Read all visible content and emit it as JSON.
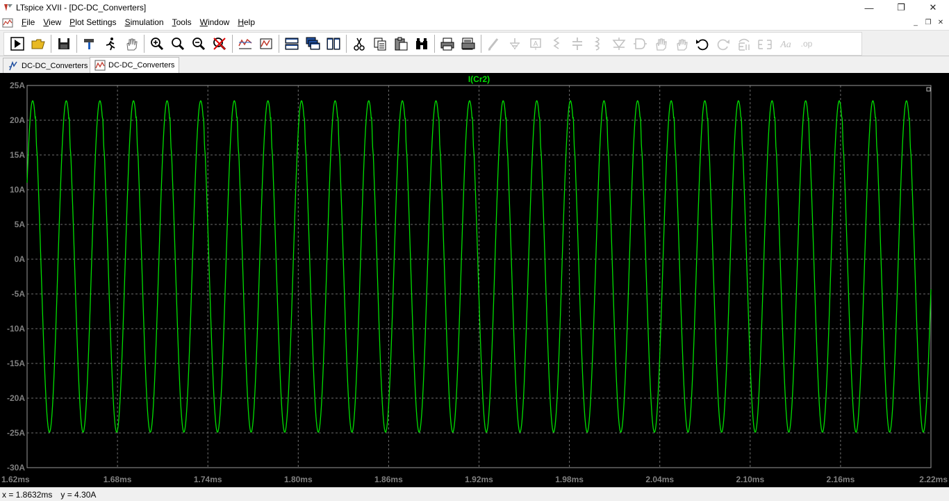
{
  "window": {
    "title": "LTspice XVII - [DC-DC_Converters]",
    "minimize": "—",
    "maximize": "❐",
    "close": "✕"
  },
  "menu": {
    "items": [
      {
        "label": "File",
        "accel": "F",
        "rest": "ile"
      },
      {
        "label": "View",
        "accel": "V",
        "rest": "iew"
      },
      {
        "label": "Plot Settings",
        "accel": "P",
        "rest": "lot Settings"
      },
      {
        "label": "Simulation",
        "accel": "S",
        "rest": "imulation"
      },
      {
        "label": "Tools",
        "accel": "T",
        "rest": "ools"
      },
      {
        "label": "Window",
        "accel": "W",
        "rest": "indow"
      },
      {
        "label": "Help",
        "accel": "H",
        "rest": "elp"
      }
    ],
    "mdi_min": "_",
    "mdi_restore": "❐",
    "mdi_close": "✕"
  },
  "tabs": [
    {
      "label": "DC-DC_Converters",
      "icon": "schematic-icon",
      "active": false
    },
    {
      "label": "DC-DC_Converters",
      "icon": "waveform-icon",
      "active": true
    }
  ],
  "toolbar": {
    "groups": [
      [
        "run-icon",
        "open-icon"
      ],
      [
        "save-icon"
      ],
      [
        "hammer-icon",
        "running-man-icon",
        "hand-icon"
      ],
      [
        "zoom-in-icon",
        "zoom-area-icon",
        "zoom-out-icon",
        "zoom-cancel-icon"
      ],
      [
        "autorange-icon",
        "annotate-icon"
      ],
      [
        "tile-horizontal-icon",
        "cascade-icon",
        "tile-vertical-icon"
      ],
      [
        "scissors-icon",
        "copy-icon",
        "paste-icon",
        "binoculars-icon"
      ],
      [
        "print-icon",
        "print-preview-icon"
      ],
      [
        "wire-icon",
        "ground-icon",
        "label-icon",
        "resistor-icon",
        "capacitor-icon",
        "inductor-icon",
        "diode-icon",
        "component-icon",
        "move-icon",
        "drag-icon",
        "undo-icon",
        "redo-icon",
        "rotate-icon",
        "mirror-icon",
        "text-icon",
        "spice-directive-icon"
      ]
    ]
  },
  "colors": {
    "trace": "#00e000",
    "grid": "#6e6e6e",
    "axis_text": "#808080",
    "background": "#000000",
    "trace_label": "#00e000"
  },
  "status": {
    "x": "x = 1.8632ms",
    "y": "y = 4.30A"
  },
  "chart_data": {
    "type": "line",
    "series": [
      {
        "name": "I(Cr2)",
        "period_ms": 0.02231,
        "max": 22.8,
        "min": -24.9,
        "start_value": 11.0,
        "start_ms": 1.62
      }
    ],
    "x_ticks": [
      "1.62ms",
      "1.68ms",
      "1.74ms",
      "1.80ms",
      "1.86ms",
      "1.92ms",
      "1.98ms",
      "2.04ms",
      "2.10ms",
      "2.16ms",
      "2.22ms"
    ],
    "y_ticks": [
      "25A",
      "20A",
      "15A",
      "10A",
      "5A",
      "0A",
      "-5A",
      "-10A",
      "-15A",
      "-20A",
      "-25A",
      "-30A"
    ],
    "xlim": [
      1.62,
      2.22
    ],
    "ylim": [
      -30,
      25
    ],
    "grid": true
  }
}
